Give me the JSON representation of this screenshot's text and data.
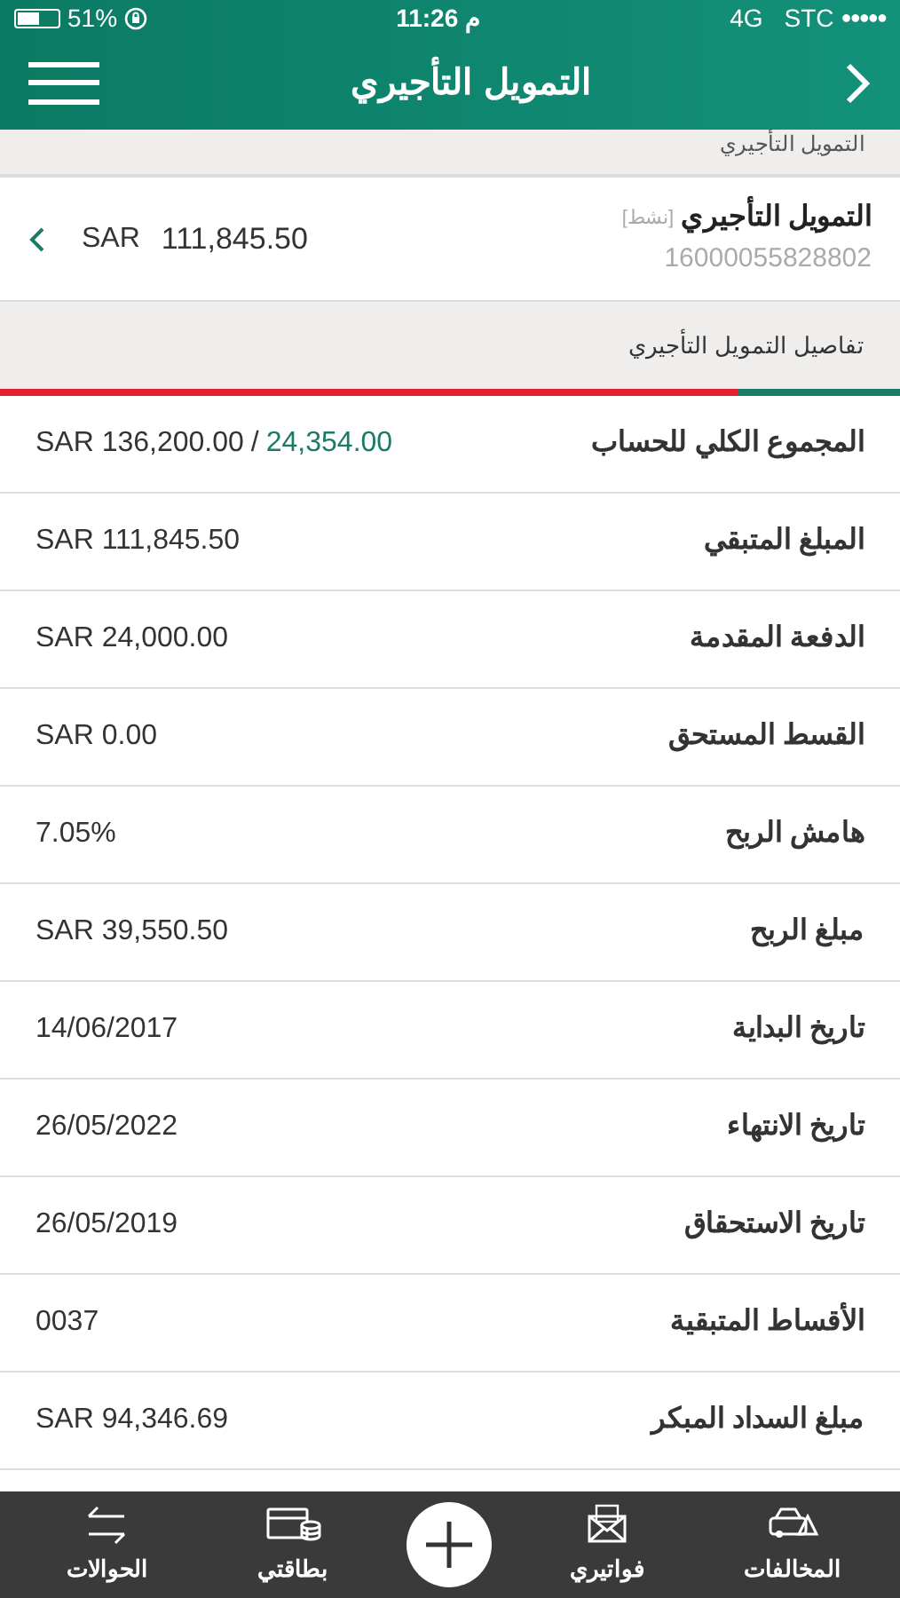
{
  "status_bar": {
    "carrier": "STC",
    "signal_dots": "●●●●●",
    "network": "4G",
    "time": "11:26 م",
    "battery": "51%"
  },
  "header": {
    "title": "التمويل التأجيري"
  },
  "breadcrumb": "التمويل التأجيري",
  "account": {
    "name": "التمويل التأجيري",
    "status": "[نشط]",
    "number": "16000055828802",
    "currency": "SAR",
    "balance": "111,845.50"
  },
  "section": {
    "title": "تفاصيل التمويل التأجيري",
    "level": 0.179
  },
  "rows": [
    {
      "kind": "split",
      "label": "المجموع الكلي للحساب",
      "value": "SAR 136,200.00",
      "separator": "/",
      "paid": "24,354.00"
    },
    {
      "kind": "plain",
      "label": "المبلغ المتبقي",
      "value": "SAR 111,845.50"
    },
    {
      "kind": "plain",
      "label": "الدفعة المقدمة",
      "value": "SAR 24,000.00"
    },
    {
      "kind": "plain",
      "label": "القسط المستحق",
      "value": "SAR 0.00"
    },
    {
      "kind": "plain",
      "label": "هامش الربح",
      "value": "7.05%"
    },
    {
      "kind": "plain",
      "label": "مبلغ الربح",
      "value": "SAR 39,550.50"
    },
    {
      "kind": "plain",
      "label": "تاريخ البداية",
      "value": "14/06/2017"
    },
    {
      "kind": "plain",
      "label": "تاريخ الانتهاء",
      "value": "26/05/2022"
    },
    {
      "kind": "plain",
      "label": "تاريخ الاستحقاق",
      "value": "26/05/2019"
    },
    {
      "kind": "plain",
      "label": "الأقساط المتبقية",
      "value": "0037"
    },
    {
      "kind": "plain",
      "label": "مبلغ السداد المبكر",
      "value": "SAR 94,346.69"
    }
  ],
  "tab_bar": [
    {
      "kind": "link",
      "label": "المخالفات"
    },
    {
      "kind": "link",
      "label": "فواتيري"
    },
    {
      "kind": "add"
    },
    {
      "kind": "link",
      "label": "بطاقتي"
    },
    {
      "kind": "link",
      "label": "الحوالات"
    }
  ]
}
